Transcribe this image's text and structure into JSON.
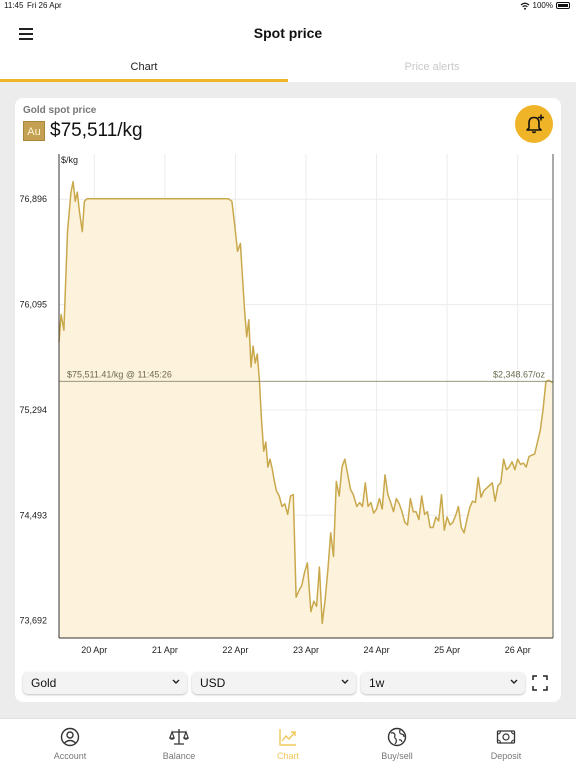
{
  "status_bar": {
    "time": "11:45",
    "date": "Fri 26 Apr",
    "battery": "100%"
  },
  "header": {
    "title": "Spot price"
  },
  "tabs": [
    {
      "label": "Chart",
      "active": true
    },
    {
      "label": "Price alerts",
      "active": false
    }
  ],
  "card": {
    "label": "Gold spot price",
    "symbol": "Au",
    "price": "$75,511/kg"
  },
  "chart_data": {
    "type": "area",
    "ylabel": "$/kg",
    "y_ticks": [
      "76,896",
      "76,095",
      "75,294",
      "74,493",
      "73,692"
    ],
    "y_tick_values": [
      76896,
      76095,
      75294,
      74493,
      73692
    ],
    "x_ticks": [
      "20 Apr",
      "21 Apr",
      "22 Apr",
      "23 Apr",
      "24 Apr",
      "25 Apr",
      "26 Apr"
    ],
    "ylim": [
      73560,
      77240
    ],
    "xlim": [
      19.5,
      26.5
    ],
    "current_value": 75511.41,
    "current_label": "$75,511.41/kg @ 11:45:26",
    "current_oz_label": "$2,348.67/oz",
    "grid": true,
    "line_color": "#c9a84c",
    "fill_color": "#fdf3dc",
    "x": [
      19.5,
      19.53,
      19.57,
      19.62,
      19.67,
      19.7,
      19.73,
      19.76,
      19.79,
      19.83,
      19.86,
      19.9,
      19.95,
      20.0,
      20.3,
      20.6,
      20.9,
      21.2,
      21.5,
      21.8,
      21.9,
      21.95,
      21.99,
      22.03,
      22.07,
      22.1,
      22.13,
      22.16,
      22.19,
      22.22,
      22.25,
      22.28,
      22.31,
      22.34,
      22.37,
      22.4,
      22.43,
      22.46,
      22.49,
      22.52,
      22.55,
      22.58,
      22.62,
      22.66,
      22.7,
      22.74,
      22.78,
      22.82,
      22.86,
      22.9,
      22.94,
      22.98,
      23.02,
      23.07,
      23.11,
      23.15,
      23.19,
      23.23,
      23.27,
      23.31,
      23.35,
      23.39,
      23.43,
      23.47,
      23.51,
      23.55,
      23.59,
      23.63,
      23.67,
      23.72,
      23.76,
      23.8,
      23.84,
      23.88,
      23.92,
      23.96,
      24.0,
      24.04,
      24.08,
      24.12,
      24.16,
      24.2,
      24.24,
      24.28,
      24.32,
      24.36,
      24.4,
      24.44,
      24.48,
      24.52,
      24.56,
      24.6,
      24.64,
      24.68,
      24.72,
      24.76,
      24.8,
      24.84,
      24.88,
      24.92,
      24.96,
      25.0,
      25.04,
      25.08,
      25.12,
      25.16,
      25.2,
      25.24,
      25.28,
      25.32,
      25.36,
      25.4,
      25.44,
      25.48,
      25.52,
      25.56,
      25.6,
      25.64,
      25.68,
      25.72,
      25.76,
      25.8,
      25.84,
      25.88,
      25.92,
      25.96,
      26.0,
      26.04,
      26.08,
      26.12,
      26.16,
      26.2,
      26.24,
      26.28,
      26.32,
      26.36,
      26.4,
      26.44,
      26.48,
      26.5
    ],
    "y": [
      75810,
      76020,
      75900,
      76650,
      76950,
      77030,
      76880,
      76950,
      76800,
      76650,
      76880,
      76900,
      76900,
      76900,
      76900,
      76900,
      76900,
      76900,
      76900,
      76900,
      76900,
      76880,
      76700,
      76500,
      76560,
      76300,
      76050,
      75850,
      75980,
      75620,
      75780,
      75650,
      75720,
      75520,
      75220,
      74980,
      75050,
      74860,
      74920,
      74850,
      74760,
      74680,
      74640,
      74560,
      74580,
      74500,
      74640,
      74650,
      73870,
      73920,
      73960,
      74060,
      74130,
      73760,
      73840,
      73800,
      74100,
      73670,
      73850,
      74080,
      74360,
      74180,
      74750,
      74640,
      74860,
      74920,
      74810,
      74690,
      74650,
      74560,
      74590,
      74560,
      74740,
      74560,
      74590,
      74510,
      74540,
      74620,
      74540,
      74800,
      74650,
      74590,
      74520,
      74620,
      74580,
      74520,
      74440,
      74420,
      74620,
      74520,
      74520,
      74460,
      74640,
      74500,
      74520,
      74400,
      74400,
      74480,
      74450,
      74650,
      74380,
      74480,
      74420,
      74440,
      74490,
      74560,
      74400,
      74360,
      74460,
      74550,
      74600,
      74590,
      74780,
      74630,
      74680,
      74700,
      74720,
      74740,
      74600,
      74720,
      74740,
      74920,
      74840,
      74860,
      74900,
      74840,
      74920,
      74880,
      74890,
      74860,
      74940,
      74950,
      74960,
      75050,
      75140,
      75300,
      75510,
      75520,
      75505,
      75511
    ]
  },
  "controls": {
    "asset": "Gold",
    "currency": "USD",
    "period": "1w"
  },
  "bottom_nav": [
    {
      "label": "Account",
      "icon": "account-icon"
    },
    {
      "label": "Balance",
      "icon": "balance-scale-icon"
    },
    {
      "label": "Chart",
      "icon": "chart-trend-icon",
      "active": true
    },
    {
      "label": "Buy/sell",
      "icon": "globe-icon"
    },
    {
      "label": "Deposit",
      "icon": "deposit-icon"
    }
  ],
  "colors": {
    "accent": "#f0b429",
    "badge": "#c4a052",
    "line": "#c9a84c"
  }
}
